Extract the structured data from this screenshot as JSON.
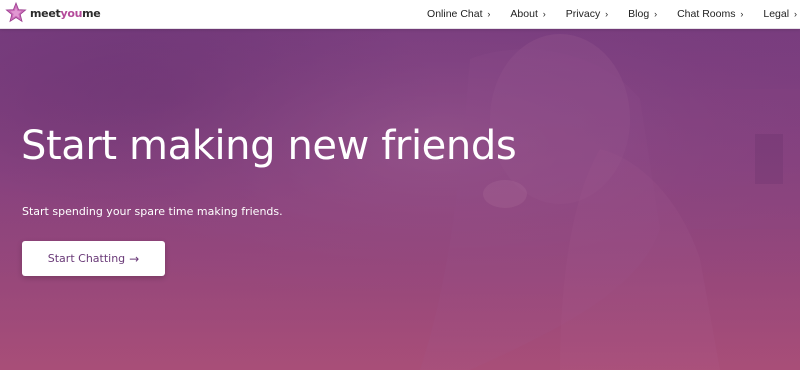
{
  "brand": {
    "name_part1": "meet",
    "name_part2": "you",
    "name_part3": "me",
    "logo_icon": "star-logo-icon",
    "accent_color": "#b44a9a"
  },
  "nav": {
    "items": [
      {
        "label": "Online Chat",
        "chevron": "›"
      },
      {
        "label": "About",
        "chevron": "›"
      },
      {
        "label": "Privacy",
        "chevron": "›"
      },
      {
        "label": "Blog",
        "chevron": "›"
      },
      {
        "label": "Chat Rooms",
        "chevron": "›"
      },
      {
        "label": "Legal",
        "chevron": "›"
      }
    ]
  },
  "hero": {
    "title": "Start making new friends",
    "subtitle": "Start spending your spare time making friends.",
    "cta_label": "Start Chatting",
    "cta_arrow": "→",
    "overlay_color": "#8a4684"
  }
}
